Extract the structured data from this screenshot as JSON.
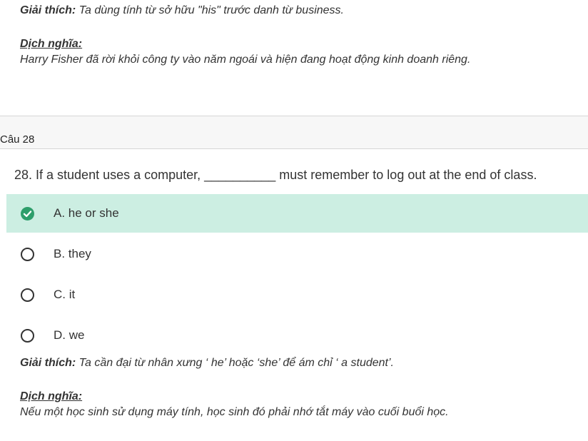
{
  "prev_explanation": {
    "label": "Giải thích:",
    "text": " Ta dùng tính từ sở hữu \"his\" trước danh từ business.",
    "translation_heading": "Dịch nghĩa:",
    "translation_text": "Harry Fisher đã rời khỏi công ty vào năm ngoái và hiện đang hoạt động kinh doanh riêng."
  },
  "section": {
    "title": "Câu 28"
  },
  "question": {
    "text": "28. If a student uses a computer, __________ must remember to log out at the end of class."
  },
  "options": [
    {
      "label": "A. he or she",
      "correct": true
    },
    {
      "label": "B. they",
      "correct": false
    },
    {
      "label": "C. it",
      "correct": false
    },
    {
      "label": "D. we",
      "correct": false
    }
  ],
  "explanation": {
    "label": "Giải thích:",
    "text": " Ta cần đại từ nhân xưng ‘ he’ hoặc ‘she’ để ám chỉ ‘ a student’.",
    "translation_heading": "Dịch nghĩa:",
    "translation_text": "Nếu một học sinh sử dụng máy tính, học sinh đó phải nhớ tắt máy vào cuối buổi học."
  },
  "colors": {
    "correct_bg": "#cceee2",
    "check_green": "#2e9e6b",
    "section_bg": "#f7f7f7"
  }
}
